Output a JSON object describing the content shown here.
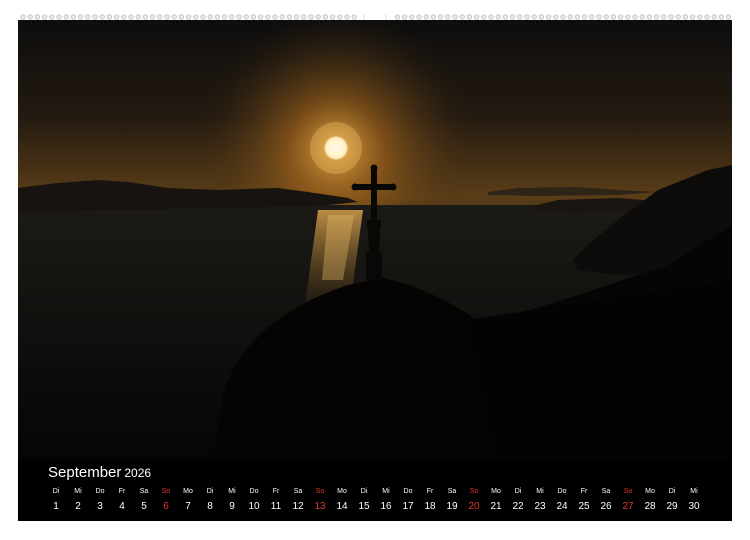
{
  "calendar": {
    "month": "September",
    "year": "2026",
    "weekdays": [
      "Di",
      "Mi",
      "Do",
      "Fr",
      "Sa",
      "So",
      "Mo",
      "Di",
      "Mi",
      "Do",
      "Fr",
      "Sa",
      "So",
      "Mo",
      "Di",
      "Mi",
      "Do",
      "Fr",
      "Sa",
      "So",
      "Mo",
      "Di",
      "Mi",
      "Do",
      "Fr",
      "Sa",
      "So",
      "Mo",
      "Di",
      "Mi"
    ],
    "days": [
      "1",
      "2",
      "3",
      "4",
      "5",
      "6",
      "7",
      "8",
      "9",
      "10",
      "11",
      "12",
      "13",
      "14",
      "15",
      "16",
      "17",
      "18",
      "19",
      "20",
      "21",
      "22",
      "23",
      "24",
      "25",
      "26",
      "27",
      "28",
      "29",
      "30"
    ],
    "sunday_color": "#e03a2f",
    "text_color": "#ffffff"
  },
  "photo": {
    "subject": "sunset-cross-silhouette",
    "sky_color": "#3a2a14",
    "sun_color": "#fff2c8"
  }
}
